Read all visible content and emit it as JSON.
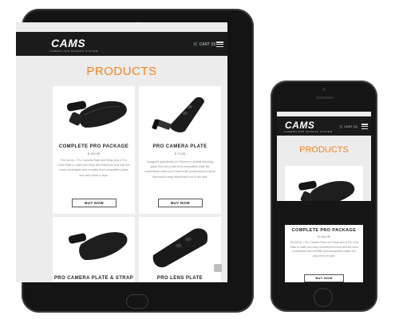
{
  "brand": {
    "name": "CAMS",
    "tagline": "CAMERA AND MAKEUP SYSTEM"
  },
  "nav": {
    "cart_label": "CART",
    "cart_count": "(0)"
  },
  "page": {
    "title": "PRODUCTS"
  },
  "products": [
    {
      "name": "COMPLETE PRO PACKAGE",
      "price": "$ 154.95",
      "description": "The full kit – Pro Camera Plate and Strap plus a Pro Lens Plate to outfit your body and telephoto lens with the most comfortable and versatile Arca-compatible plates and carry them in style.",
      "button": "BUY NOW"
    },
    {
      "name": "PRO CAMERA PLATE",
      "price": "$ 74.95",
      "description": "Designed specifically for Fitment or vertical shooting grips, this low profile Arca-compatible plate fits comfortably under your hand while positioning the quick disconnect strap attachment out of the way.",
      "button": "BUY NOW"
    },
    {
      "name": "PRO CAMERA PLATE & STRAP"
    },
    {
      "name": "PRO LENS PLATE"
    }
  ],
  "phone": {
    "product": {
      "name": "COMPLETE PRO PACKAGE",
      "price": "$ 154.95",
      "description": "The full kit – Pro Camera Plate and Strap plus a Pro Lens Plate to outfit your body and telephoto lens with the most comfortable and versatile Arca-compatible plates and carry them in style.",
      "button": "BUY NOW"
    }
  },
  "colors": {
    "accent": "#f3831f",
    "nav_bg": "#1b1b1b",
    "screen_bg": "#ececec"
  },
  "icons": {
    "menu": "hamburger-menu-icon",
    "cart": "cart-icon",
    "scroll_top": "arrow-up-icon"
  }
}
